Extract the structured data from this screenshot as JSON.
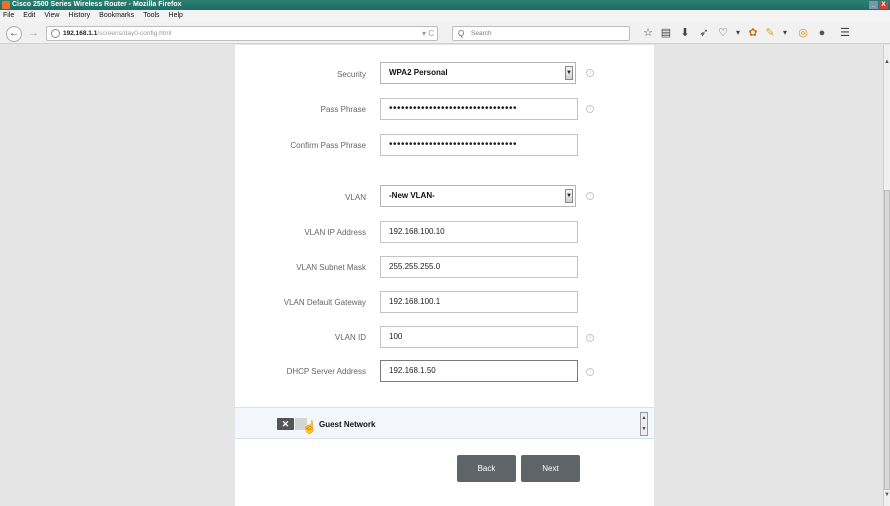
{
  "window": {
    "title": "Cisco 2500 Series Wireless Router - Mozilla Firefox",
    "controls": [
      "_",
      "X"
    ]
  },
  "menu": [
    "File",
    "Edit",
    "View",
    "History",
    "Bookmarks",
    "Tools",
    "Help"
  ],
  "nav": {
    "url_host": "192.168.1.1",
    "url_path": "/screens/day0-config.html",
    "search_placeholder": "Search",
    "back_glyph": "←",
    "forward_glyph": "→",
    "reload_glyph": "▾ C",
    "search_glyph": "Q"
  },
  "toolbar_icons": [
    "star-icon",
    "library-icon",
    "download-icon",
    "send-icon",
    "pocket-icon",
    "menu-caret-icon",
    "addon-icon",
    "menu-caret-icon",
    "firefox-icon",
    "chat-icon",
    "hamburger-menu-icon"
  ],
  "form": {
    "security": {
      "label": "Security",
      "value": "WPA2 Personal"
    },
    "pass_phrase": {
      "label": "Pass Phrase",
      "value": "••••••••••••••••••••••••••••••••"
    },
    "confirm_pass_phrase": {
      "label": "Confirm Pass Phrase",
      "value": "••••••••••••••••••••••••••••••••"
    },
    "vlan": {
      "label": "VLAN",
      "value": "-New VLAN-"
    },
    "vlan_ip": {
      "label": "VLAN IP Address",
      "value": "192.168.100.10"
    },
    "vlan_mask": {
      "label": "VLAN Subnet Mask",
      "value": "255.255.255.0"
    },
    "vlan_gateway": {
      "label": "VLAN Default Gateway",
      "value": "192.168.100.1"
    },
    "vlan_id": {
      "label": "VLAN ID",
      "value": "100"
    },
    "dhcp_server": {
      "label": "DHCP Server Address",
      "value": "192.168.1.50"
    }
  },
  "guest": {
    "label": "Guest Network",
    "toggle_glyph": "✕"
  },
  "buttons": {
    "back": "Back",
    "next": "Next"
  },
  "colors": {
    "titlebar": "#1f6c62",
    "button": "#5f6468",
    "accent_strip": "#f3f7fb"
  }
}
